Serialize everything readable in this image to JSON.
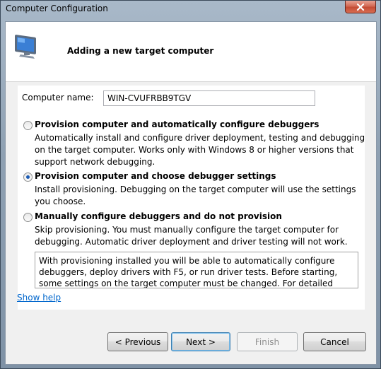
{
  "window": {
    "title": "Computer Configuration",
    "close_icon": "close-icon"
  },
  "header": {
    "title": "Adding a new target computer",
    "icon": "computer-monitor-icon"
  },
  "computer_name": {
    "label": "Computer name:",
    "value": "WIN-CVUFRBB9TGV"
  },
  "options": [
    {
      "title": "Provision computer and automatically configure debuggers",
      "description": "Automatically install and configure driver deployment, testing and debugging on the target computer. Works only with Windows 8 or higher versions that support network debugging.",
      "selected": false
    },
    {
      "title": "Provision computer and choose debugger settings",
      "description": "Install provisioning. Debugging on the target computer will use the settings you choose.",
      "selected": true
    },
    {
      "title": "Manually configure debuggers and do not provision",
      "description": "Skip provisioning. You must manually configure the target computer for debugging. Automatic driver deployment and driver testing will not work.",
      "selected": false
    }
  ],
  "info_text": "With provisioning installed you will be able to automatically configure debuggers, deploy drivers with F5, or run driver tests. Before starting, some settings on the target computer must be changed. For detailed instructions",
  "show_help": "Show help",
  "buttons": {
    "previous": "< Previous",
    "next": "Next >",
    "finish": "Finish",
    "cancel": "Cancel"
  },
  "colors": {
    "link": "#0066cc",
    "radio_selected": "#1c5cb4",
    "close_button": "#c44c35"
  }
}
